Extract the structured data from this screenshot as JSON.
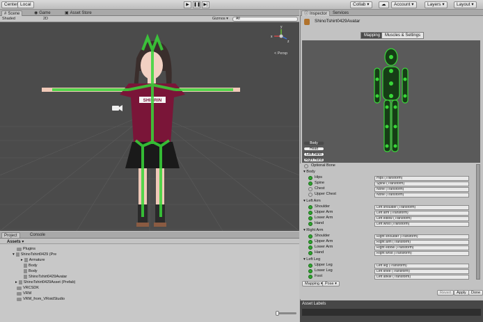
{
  "toolbar": {
    "shaded_label": "Shaded",
    "center_label": "Center",
    "local_label": "Local",
    "play_icon": "▶",
    "pause_icon": "❚❚",
    "step_icon": "▶|",
    "collab_label": "Collab ▾",
    "cloud_icon": "☁",
    "account_label": "Account ▾",
    "layers_label": "Layers ▾",
    "layout_label": "Layout ▾"
  },
  "scene_tabs": [
    "Scene",
    "Game",
    "Asset Store"
  ],
  "scene_bar": {
    "shaded": "Shaded",
    "twod": "2D",
    "gizmos": "Gizmos ▾",
    "search_placeholder": "All"
  },
  "scene": {
    "persp_label": "< Persp",
    "shirt_text": "SHINRIN",
    "gizmo_x": "x",
    "gizmo_y": "y",
    "gizmo_z": "z"
  },
  "project": {
    "tabs": [
      "Project",
      "Console"
    ],
    "assets_label": "Assets ▾",
    "items": [
      {
        "label": "Plugins",
        "indent": 0,
        "kind": "folder"
      },
      {
        "label": "ShinoTshirt0429 (Pre",
        "indent": 0,
        "kind": "prefab"
      },
      {
        "label": "Armature",
        "indent": 1,
        "kind": "file"
      },
      {
        "label": "Body",
        "indent": 1,
        "kind": "file"
      },
      {
        "label": "Body",
        "indent": 1,
        "kind": "file"
      },
      {
        "label": "ShinoTshirt0429Avatar",
        "indent": 1,
        "kind": "file"
      },
      {
        "label": "ShinoTshirt0429Asset (Prefab)",
        "indent": 0,
        "kind": "prefab"
      },
      {
        "label": "VRCSDK",
        "indent": 0,
        "kind": "folder"
      },
      {
        "label": "VRM",
        "indent": 0,
        "kind": "folder"
      },
      {
        "label": "VRM_from_VRoidStudio",
        "indent": 0,
        "kind": "folder"
      }
    ]
  },
  "inspector": {
    "tabs": [
      "Inspector",
      "Services"
    ],
    "title": "ShinoTshirt0429Avatar",
    "mapping_label": "Mapping",
    "muscles_label": "Muscles & Settings",
    "body_buttons": [
      "Body",
      "Head",
      "Left Hand",
      "Right Hand"
    ],
    "optional_bone": "Optional Bone",
    "sections": [
      {
        "title": "▾ Body",
        "bones": [
          {
            "name": "Hips",
            "value": "Hips (Transform)",
            "filled": true
          },
          {
            "name": "Spine",
            "value": "Spine (Transform)",
            "filled": true
          },
          {
            "name": "Chest",
            "value": "None (Transform)",
            "filled": false
          },
          {
            "name": "Upper Chest",
            "value": "None (Transform)",
            "filled": false
          }
        ]
      },
      {
        "title": "▾ Left Arm",
        "bones": [
          {
            "name": "Shoulder",
            "value": "Left shoulder (Transform)",
            "filled": true
          },
          {
            "name": "Upper Arm",
            "value": "Left arm (Transform)",
            "filled": true
          },
          {
            "name": "Lower Arm",
            "value": "Left elbow (Transform)",
            "filled": true
          },
          {
            "name": "Hand",
            "value": "Left wrist (Transform)",
            "filled": true
          }
        ]
      },
      {
        "title": "▾ Right Arm",
        "bones": [
          {
            "name": "Shoulder",
            "value": "Right shoulder (Transform)",
            "filled": true
          },
          {
            "name": "Upper Arm",
            "value": "Right arm (Transform)",
            "filled": true
          },
          {
            "name": "Lower Arm",
            "value": "Right elbow (Transform)",
            "filled": true
          },
          {
            "name": "Hand",
            "value": "Right wrist (Transform)",
            "filled": true
          }
        ]
      },
      {
        "title": "▾ Left Leg",
        "bones": [
          {
            "name": "Upper Leg",
            "value": "Left leg (Transform)",
            "filled": true
          },
          {
            "name": "Lower Leg",
            "value": "Left knee (Transform)",
            "filled": true
          },
          {
            "name": "Foot",
            "value": "Left ankle (Transform)",
            "filled": true
          }
        ]
      }
    ],
    "footer_mapping": "Mapping ▾",
    "footer_pose": "Pose ▾",
    "revert_label": "Revert",
    "apply_label": "Apply",
    "done_label": "Done",
    "asset_labels": "Asset Labels"
  },
  "colors": {
    "bone_green": "#39d639",
    "scene_bg": "#4b4b4b",
    "shirt": "#7a1538",
    "skirt": "#1a1a1a"
  }
}
